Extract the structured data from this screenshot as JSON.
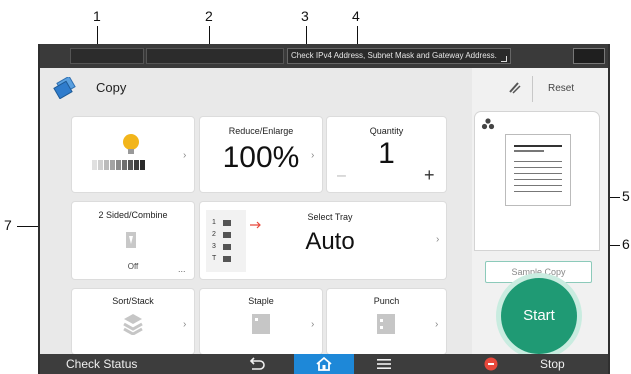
{
  "status_bar": {
    "message": "Check IPv4 Address, Subnet Mask and Gateway Address."
  },
  "header": {
    "app_title": "Copy",
    "reset_label": "Reset"
  },
  "tiles": {
    "density": {
      "icon": "bulb-icon"
    },
    "reduce_enlarge": {
      "label": "Reduce/Enlarge",
      "value": "100%"
    },
    "quantity": {
      "label": "Quantity",
      "value": "1",
      "minus": "–",
      "plus": "+"
    },
    "two_sided": {
      "label": "2 Sided/Combine",
      "state": "Off",
      "more": "..."
    },
    "select_tray": {
      "label": "Select Tray",
      "value": "Auto",
      "trays": [
        "1",
        "2",
        "3",
        "T"
      ]
    },
    "sort_stack": {
      "label": "Sort/Stack"
    },
    "staple": {
      "label": "Staple"
    },
    "punch": {
      "label": "Punch"
    }
  },
  "right_panel": {
    "sample_copy_label": "Sample Copy",
    "start_label": "Start"
  },
  "bottom_bar": {
    "check_status_label": "Check Status",
    "stop_label": "Stop"
  },
  "callouts": [
    "1",
    "2",
    "3",
    "4",
    "5",
    "6",
    "7"
  ],
  "colors": {
    "accent_green": "#1f9a74",
    "home_blue": "#1e88d8",
    "bulb_yellow": "#f2b51b",
    "stop_red": "#e8483b"
  }
}
